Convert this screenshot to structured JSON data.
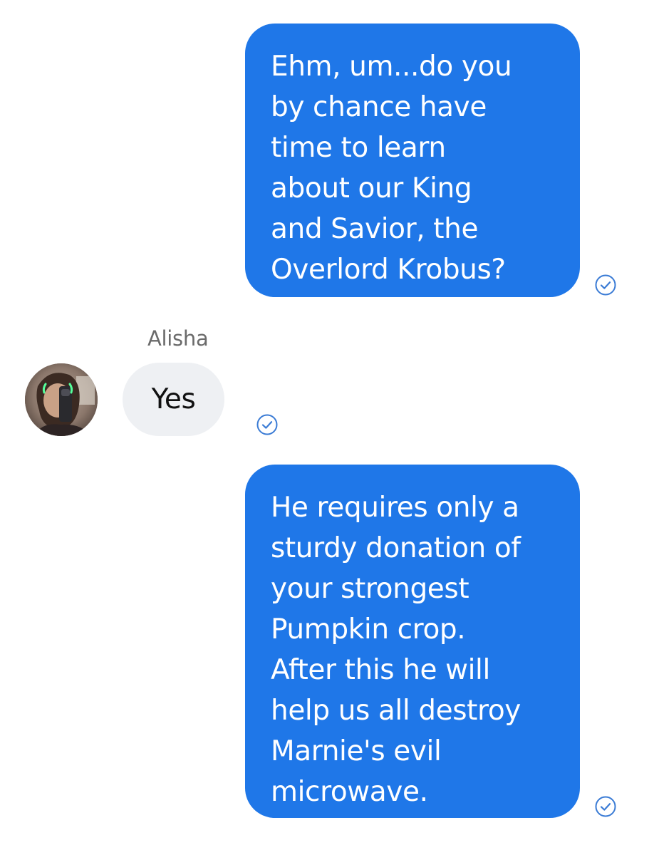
{
  "conversation": {
    "messages": [
      {
        "direction": "outgoing",
        "text": "Ehm, um...do you\nby chance have\ntime to learn\nabout our King\nand Savior, the\nOverlord Krobus?",
        "status_icon": "read-check-icon"
      },
      {
        "direction": "incoming",
        "sender": "Alisha",
        "text": "Yes",
        "status_icon": "read-check-icon"
      },
      {
        "direction": "outgoing",
        "text": "He requires only a\nsturdy donation of\nyour strongest\nPumpkin crop.\nAfter this he will\nhelp us all destroy\nMarnie's evil\nmicrowave.",
        "status_icon": "read-check-icon"
      }
    ]
  },
  "colors": {
    "outgoing_bubble": "#1f77e8",
    "incoming_bubble": "#eef0f3",
    "read_check": "#3a7bd5",
    "sender_name": "#6b6b6b"
  }
}
